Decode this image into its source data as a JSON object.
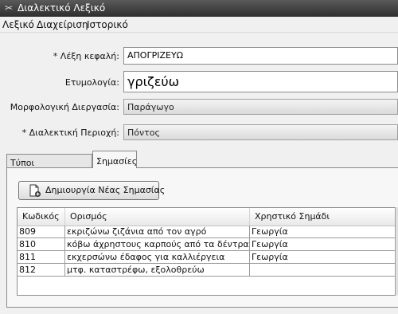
{
  "window": {
    "title": "Διαλεκτικό Λεξικό",
    "icon": "tools-icon"
  },
  "menu": [
    "Λεξικό",
    "Διαχείριση",
    "Ιστορικό"
  ],
  "form": {
    "headword_label": "* Λέξη κεφαλή:",
    "headword_value": "ΑΠΟΓΡΙΖΕΥΩ",
    "etymology_label": "Ετυμολογία:",
    "etymology_value": "γριζεύω",
    "morph_label": "Μορφολογική Διεργασία:",
    "morph_value": "Παράγωγο",
    "region_label": "* Διαλεκτική Περιοχή:",
    "region_value": "Πόντος"
  },
  "tabs": [
    {
      "label": "Τύποι Πραγμάτωσης",
      "active": false
    },
    {
      "label": "Σημασίες",
      "active": true
    }
  ],
  "create_button": {
    "label": "Δημιουργία Νέας Σημασίας",
    "icon": "new-document-icon"
  },
  "table": {
    "columns": [
      "Κωδικός",
      "Ορισμός",
      "Χρηστικό Σημάδι"
    ],
    "rows": [
      [
        "809",
        "εκριζώνω ζιζάνια από τον αγρό",
        "Γεωργία"
      ],
      [
        "810",
        "κόβω άχρηστους καρπούς από τα δέντρα",
        "Γεωργία"
      ],
      [
        "811",
        "εκχερσώνω έδαφος για καλλιέργεια",
        "Γεωργία"
      ],
      [
        "812",
        "μτφ. καταστρέφω, εξολοθρεύω",
        ""
      ]
    ]
  }
}
